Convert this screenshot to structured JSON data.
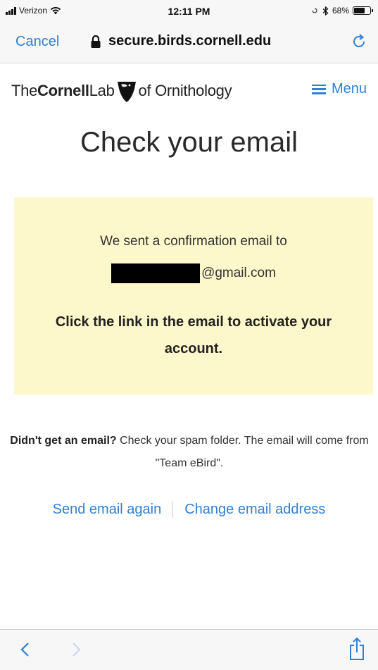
{
  "status_bar": {
    "carrier": "Verizon",
    "time": "12:11 PM",
    "battery_percent": "68%",
    "battery_level": 0.68
  },
  "browser": {
    "cancel_label": "Cancel",
    "url": "secure.birds.cornell.edu"
  },
  "site": {
    "logo": {
      "the": "The",
      "cornell": "Cornell",
      "lab": "Lab",
      "of_ornithology": "of Ornithology"
    },
    "menu_label": "Menu"
  },
  "main": {
    "title": "Check your email",
    "notice": {
      "sent_text": "We sent a confirmation email to",
      "email_domain": "@gmail.com",
      "instruction": "Click the link in the email to activate your account."
    },
    "help": {
      "bold": "Didn't get an email?",
      "text": " Check your spam folder. The email will come from \"Team eBird\"."
    },
    "links": {
      "send_again": "Send email again",
      "change_email": "Change email address"
    }
  },
  "colors": {
    "link": "#2f7fd4",
    "notice_bg": "#fdf7cc"
  }
}
